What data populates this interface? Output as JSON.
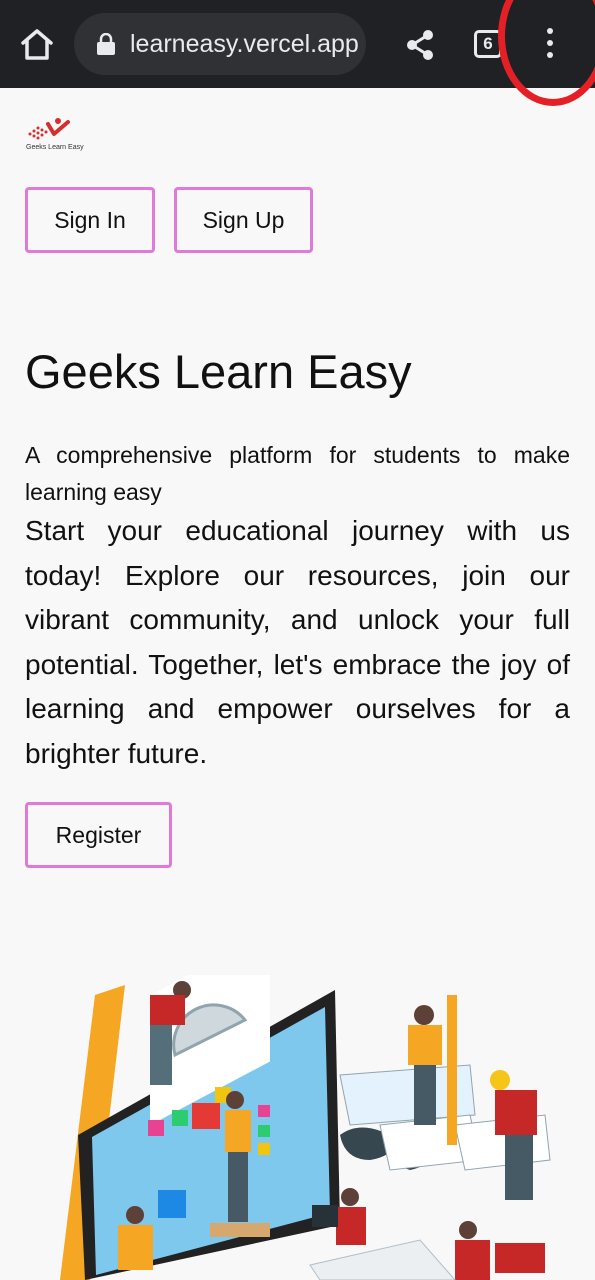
{
  "browser": {
    "url": "learneasy.vercel.app",
    "tab_count": "6",
    "icons": [
      "home-icon",
      "lock-icon",
      "share-icon",
      "tabs-icon",
      "more-menu-icon"
    ],
    "highlight_color": "#e51f26"
  },
  "site": {
    "logo_text": "Geeks Learn Easy",
    "accent_color": "#e07ad9"
  },
  "auth": {
    "sign_in_label": "Sign In",
    "sign_up_label": "Sign Up"
  },
  "hero": {
    "title": "Geeks Learn Easy",
    "subtitle": "A comprehensive platform for students to make learning easy",
    "body": "Start your educational journey with us today! Explore our resources, join our vibrant community, and unlock your full potential. Together, let's embrace the joy of learning and empower ourselves for a brighter future.",
    "register_label": "Register"
  }
}
